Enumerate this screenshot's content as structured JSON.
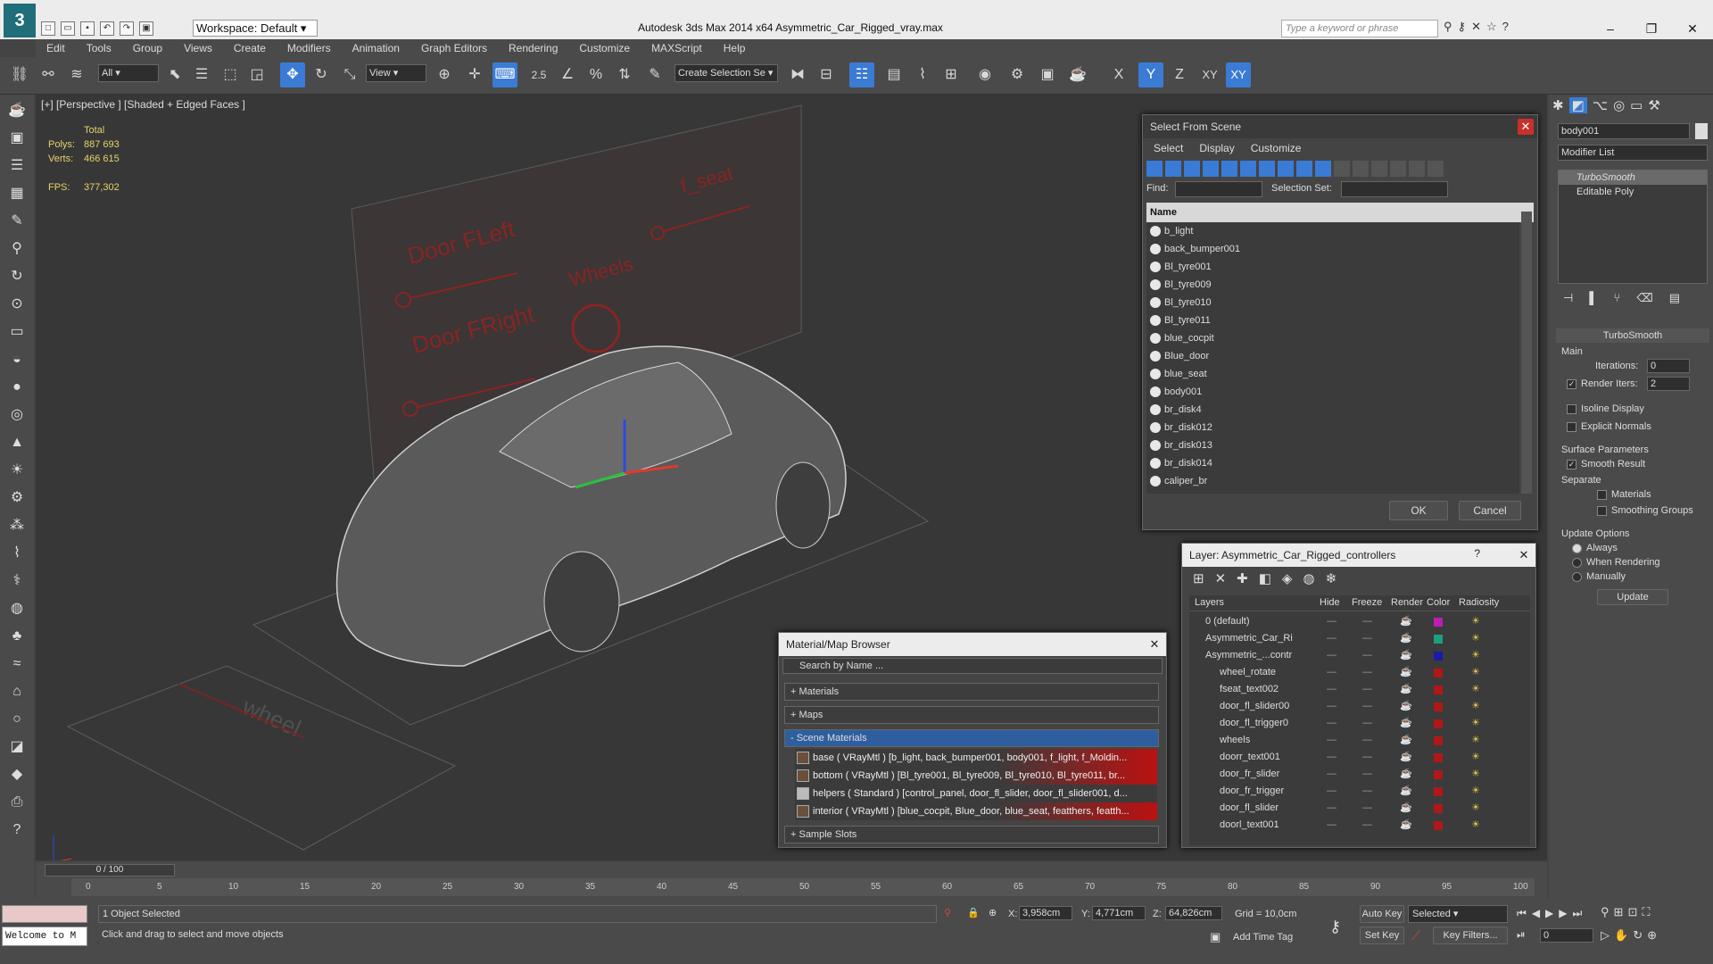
{
  "titlebar": {
    "workspace": "Workspace: Default",
    "app_title": "Autodesk 3ds Max  2014 x64    Asymmetric_Car_Rigged_vray.max",
    "search_placeholder": "Type a keyword or phrase"
  },
  "menu": [
    "Edit",
    "Tools",
    "Group",
    "Views",
    "Create",
    "Modifiers",
    "Animation",
    "Graph Editors",
    "Rendering",
    "Customize",
    "MAXScript",
    "Help"
  ],
  "toolbar": {
    "filter": "All",
    "refcoord": "View",
    "snap_value": "2.5",
    "selection_set": "Create Selection Se",
    "axis_x": "X",
    "axis_y": "Y",
    "axis_z": "Z",
    "axis_xy": "XY",
    "axis_xy2": "XY"
  },
  "viewport": {
    "label": "[+] [Perspective ] [Shaded + Edged Faces ]",
    "stats_total": "Total",
    "polys_label": "Polys:",
    "polys_value": "887 693",
    "verts_label": "Verts:",
    "verts_value": "466 615",
    "fps_label": "FPS:",
    "fps_value": "377,302",
    "labels": [
      "Door FLeft",
      "Door FRight",
      "Wheels",
      "f_seat",
      "wheel"
    ]
  },
  "select_from_scene": {
    "title": "Select From Scene",
    "menu": [
      "Select",
      "Display",
      "Customize"
    ],
    "find_label": "Find:",
    "selection_set_label": "Selection Set:",
    "column_name": "Name",
    "items": [
      "b_light",
      "back_bumper001",
      "Bl_tyre001",
      "Bl_tyre009",
      "Bl_tyre010",
      "Bl_tyre011",
      "blue_cocpit",
      "Blue_door",
      "blue_seat",
      "body001",
      "br_disk4",
      "br_disk012",
      "br_disk013",
      "br_disk014",
      "caliper_br"
    ],
    "ok": "OK",
    "cancel": "Cancel"
  },
  "layer_dialog": {
    "title": "Layer: Asymmetric_Car_Rigged_controllers",
    "help": "?",
    "columns": [
      "Layers",
      "Hide",
      "Freeze",
      "Render",
      "Color",
      "Radiosity"
    ],
    "rows": [
      {
        "name": "0 (default)",
        "color": "#c01bb5"
      },
      {
        "name": "Asymmetric_Car_Ri",
        "color": "#1aa07a"
      },
      {
        "name": "Asymmetric_...contr",
        "color": "#1b1ba8"
      },
      {
        "name": "wheel_rotate",
        "color": "#b01818"
      },
      {
        "name": "fseat_text002",
        "color": "#b01818"
      },
      {
        "name": "door_fl_slider00",
        "color": "#b01818"
      },
      {
        "name": "door_fl_trigger0",
        "color": "#b01818"
      },
      {
        "name": "wheels",
        "color": "#b01818"
      },
      {
        "name": "doorr_text001",
        "color": "#b01818"
      },
      {
        "name": "door_fr_slider",
        "color": "#b01818"
      },
      {
        "name": "door_fr_trigger",
        "color": "#b01818"
      },
      {
        "name": "door_fl_slider",
        "color": "#b01818"
      },
      {
        "name": "doorl_text001",
        "color": "#b01818"
      }
    ]
  },
  "material_browser": {
    "title": "Material/Map Browser",
    "search_placeholder": "Search by Name ...",
    "sections": [
      "+ Materials",
      "+ Maps",
      "- Scene Materials"
    ],
    "materials": [
      "base  ( VRayMtl ) [b_light, back_bumper001, body001, f_light, f_Moldin...",
      "bottom  ( VRayMtl ) [Bl_tyre001, Bl_tyre009, Bl_tyre010, Bl_tyre011, br...",
      "helpers  ( Standard ) [control_panel, door_fl_slider, door_fl_slider001, d...",
      "interior  ( VRayMtl ) [blue_cocpit, Blue_door, blue_seat, featthers, featth..."
    ],
    "sample_slots": "+ Sample Slots"
  },
  "command_panel": {
    "object_name": "body001",
    "modifier_list": "Modifier List",
    "stack": [
      "TurboSmooth",
      "Editable Poly"
    ],
    "rollout_title": "TurboSmooth",
    "main_label": "Main",
    "iterations_label": "Iterations:",
    "iterations_value": "0",
    "render_iters_label": "Render Iters:",
    "render_iters_value": "2",
    "isoline": "Isoline Display",
    "explicit_normals": "Explicit Normals",
    "surface_params": "Surface Parameters",
    "smooth_result": "Smooth Result",
    "separate": "Separate",
    "materials": "Materials",
    "smoothing_groups": "Smoothing Groups",
    "update_options": "Update Options",
    "always": "Always",
    "when_rendering": "When Rendering",
    "manually": "Manually",
    "update_btn": "Update"
  },
  "timeline": {
    "frame": "0 / 100",
    "ticks": [
      "0",
      "5",
      "10",
      "15",
      "20",
      "25",
      "30",
      "35",
      "40",
      "45",
      "50",
      "55",
      "60",
      "65",
      "70",
      "75",
      "80",
      "85",
      "90",
      "95",
      "100"
    ]
  },
  "status": {
    "maxscript": "Welcome to M",
    "selected": "1 Object Selected",
    "prompt": "Click and drag to select and move objects",
    "x_label": "X:",
    "x_value": "3,958cm",
    "y_label": "Y:",
    "y_value": "4,771cm",
    "z_label": "Z:",
    "z_value": "64,826cm",
    "grid": "Grid = 10,0cm",
    "add_time_tag": "Add Time Tag",
    "auto_key": "Auto Key",
    "set_key": "Set Key",
    "selected_dropdown": "Selected",
    "key_filters": "Key Filters...",
    "frame_value": "0"
  }
}
